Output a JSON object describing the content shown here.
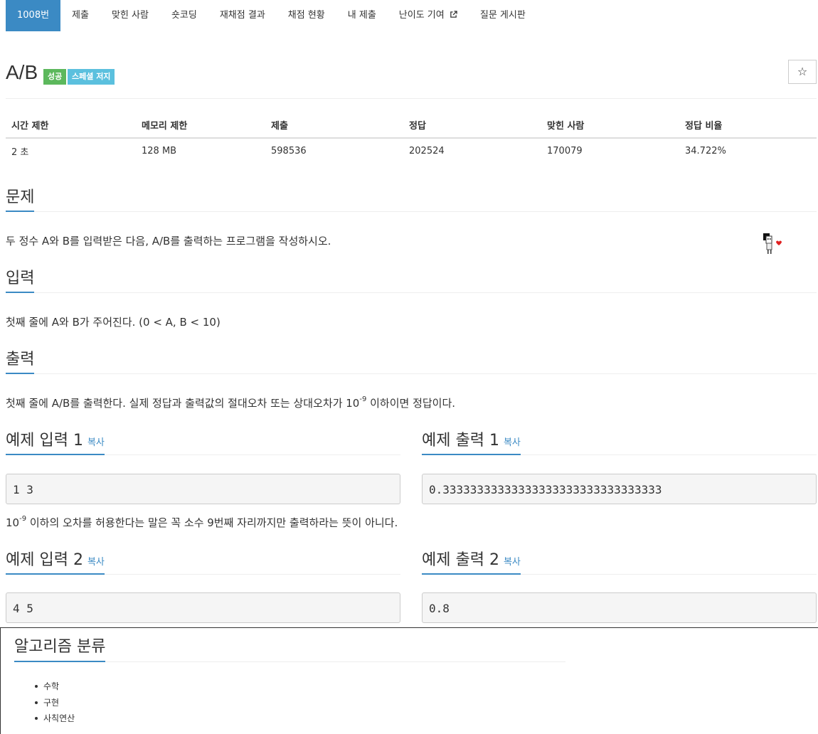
{
  "tabs": [
    {
      "label": "1008번",
      "active": true
    },
    {
      "label": "제출"
    },
    {
      "label": "맞힌 사람"
    },
    {
      "label": "숏코딩"
    },
    {
      "label": "재채점 결과"
    },
    {
      "label": "채점 현황"
    },
    {
      "label": "내 제출"
    },
    {
      "label": "난이도 기여",
      "external": true
    },
    {
      "label": "질문 게시판"
    }
  ],
  "problem": {
    "title": "A/B",
    "badge_success": "성공",
    "badge_spj": "스페셜 저지",
    "star_icon": "☆"
  },
  "info_table": {
    "headers": [
      "시간 제한",
      "메모리 제한",
      "제출",
      "정답",
      "맞힌 사람",
      "정답 비율"
    ],
    "values": [
      "2 초",
      "128 MB",
      "598536",
      "202524",
      "170079",
      "34.722%"
    ]
  },
  "sections": {
    "problem_heading": "문제",
    "problem_text": "두 정수 A와 B를 입력받은 다음, A/B를 출력하는 프로그램을 작성하시오.",
    "input_heading": "입력",
    "input_text": "첫째 줄에 A와 B가 주어진다. (0 < A, B < 10)",
    "output_heading": "출력",
    "output_text_a": "첫째 줄에 A/B를 출력한다. 실제 정답과 출력값의 절대오차 또는 상대오차가 10",
    "output_sup": "-9",
    "output_text_b": " 이하이면 정답이다."
  },
  "examples": {
    "copy_label": "복사",
    "in1_heading": "예제 입력 1",
    "in1_value": "1 3",
    "out1_heading": "예제 출력 1",
    "out1_value": "0.33333333333333333333333333333333",
    "note_a": "10",
    "note_sup": "-9",
    "note_b": " 이하의 오차를 허용한다는 말은 꼭 소수 9번째 자리까지만 출력하라는 뜻이 아니다.",
    "in2_heading": "예제 입력 2",
    "in2_value": "4 5",
    "out2_heading": "예제 출력 2",
    "out2_value": "0.8"
  },
  "algorithms": {
    "heading": "알고리즘 분류",
    "items": [
      "수학",
      "구현",
      "사칙연산"
    ]
  }
}
